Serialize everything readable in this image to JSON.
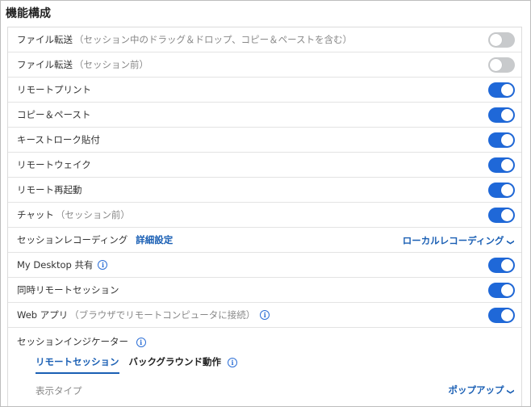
{
  "section_title": "機能構成",
  "rows": [
    {
      "label": "ファイル転送",
      "sub": "（セッション中のドラッグ＆ドロップ、コピー＆ペーストを含む）",
      "on": false
    },
    {
      "label": "ファイル転送",
      "sub": "（セッション前）",
      "on": false
    },
    {
      "label": "リモートプリント",
      "on": true
    },
    {
      "label": "コピー＆ペースト",
      "on": true
    },
    {
      "label": "キーストローク貼付",
      "on": true
    },
    {
      "label": "リモートウェイク",
      "on": true
    },
    {
      "label": "リモート再起動",
      "on": true
    },
    {
      "label": "チャット",
      "sub": "（セッション前）",
      "on": true
    }
  ],
  "recording": {
    "label": "セッションレコーディング",
    "link": "詳細設定",
    "dropdown": "ローカルレコーディング"
  },
  "my_desktop": {
    "label": "My Desktop 共有",
    "on": true
  },
  "concurrent": {
    "label": "同時リモートセッション",
    "on": true
  },
  "webapp": {
    "label": "Web アプリ",
    "sub": "（ブラウザでリモートコンピュータに接続）",
    "on": true
  },
  "indicator": {
    "title": "セッションインジケーター",
    "tabs": [
      "リモートセッション",
      "バックグラウンド動作"
    ],
    "display_type_label": "表示タイプ",
    "display_type_value": "ポップアップ"
  },
  "colors": {
    "accent": "#1f68d8",
    "toggle_off": "#c8cacc",
    "link": "#1a5fb4"
  }
}
